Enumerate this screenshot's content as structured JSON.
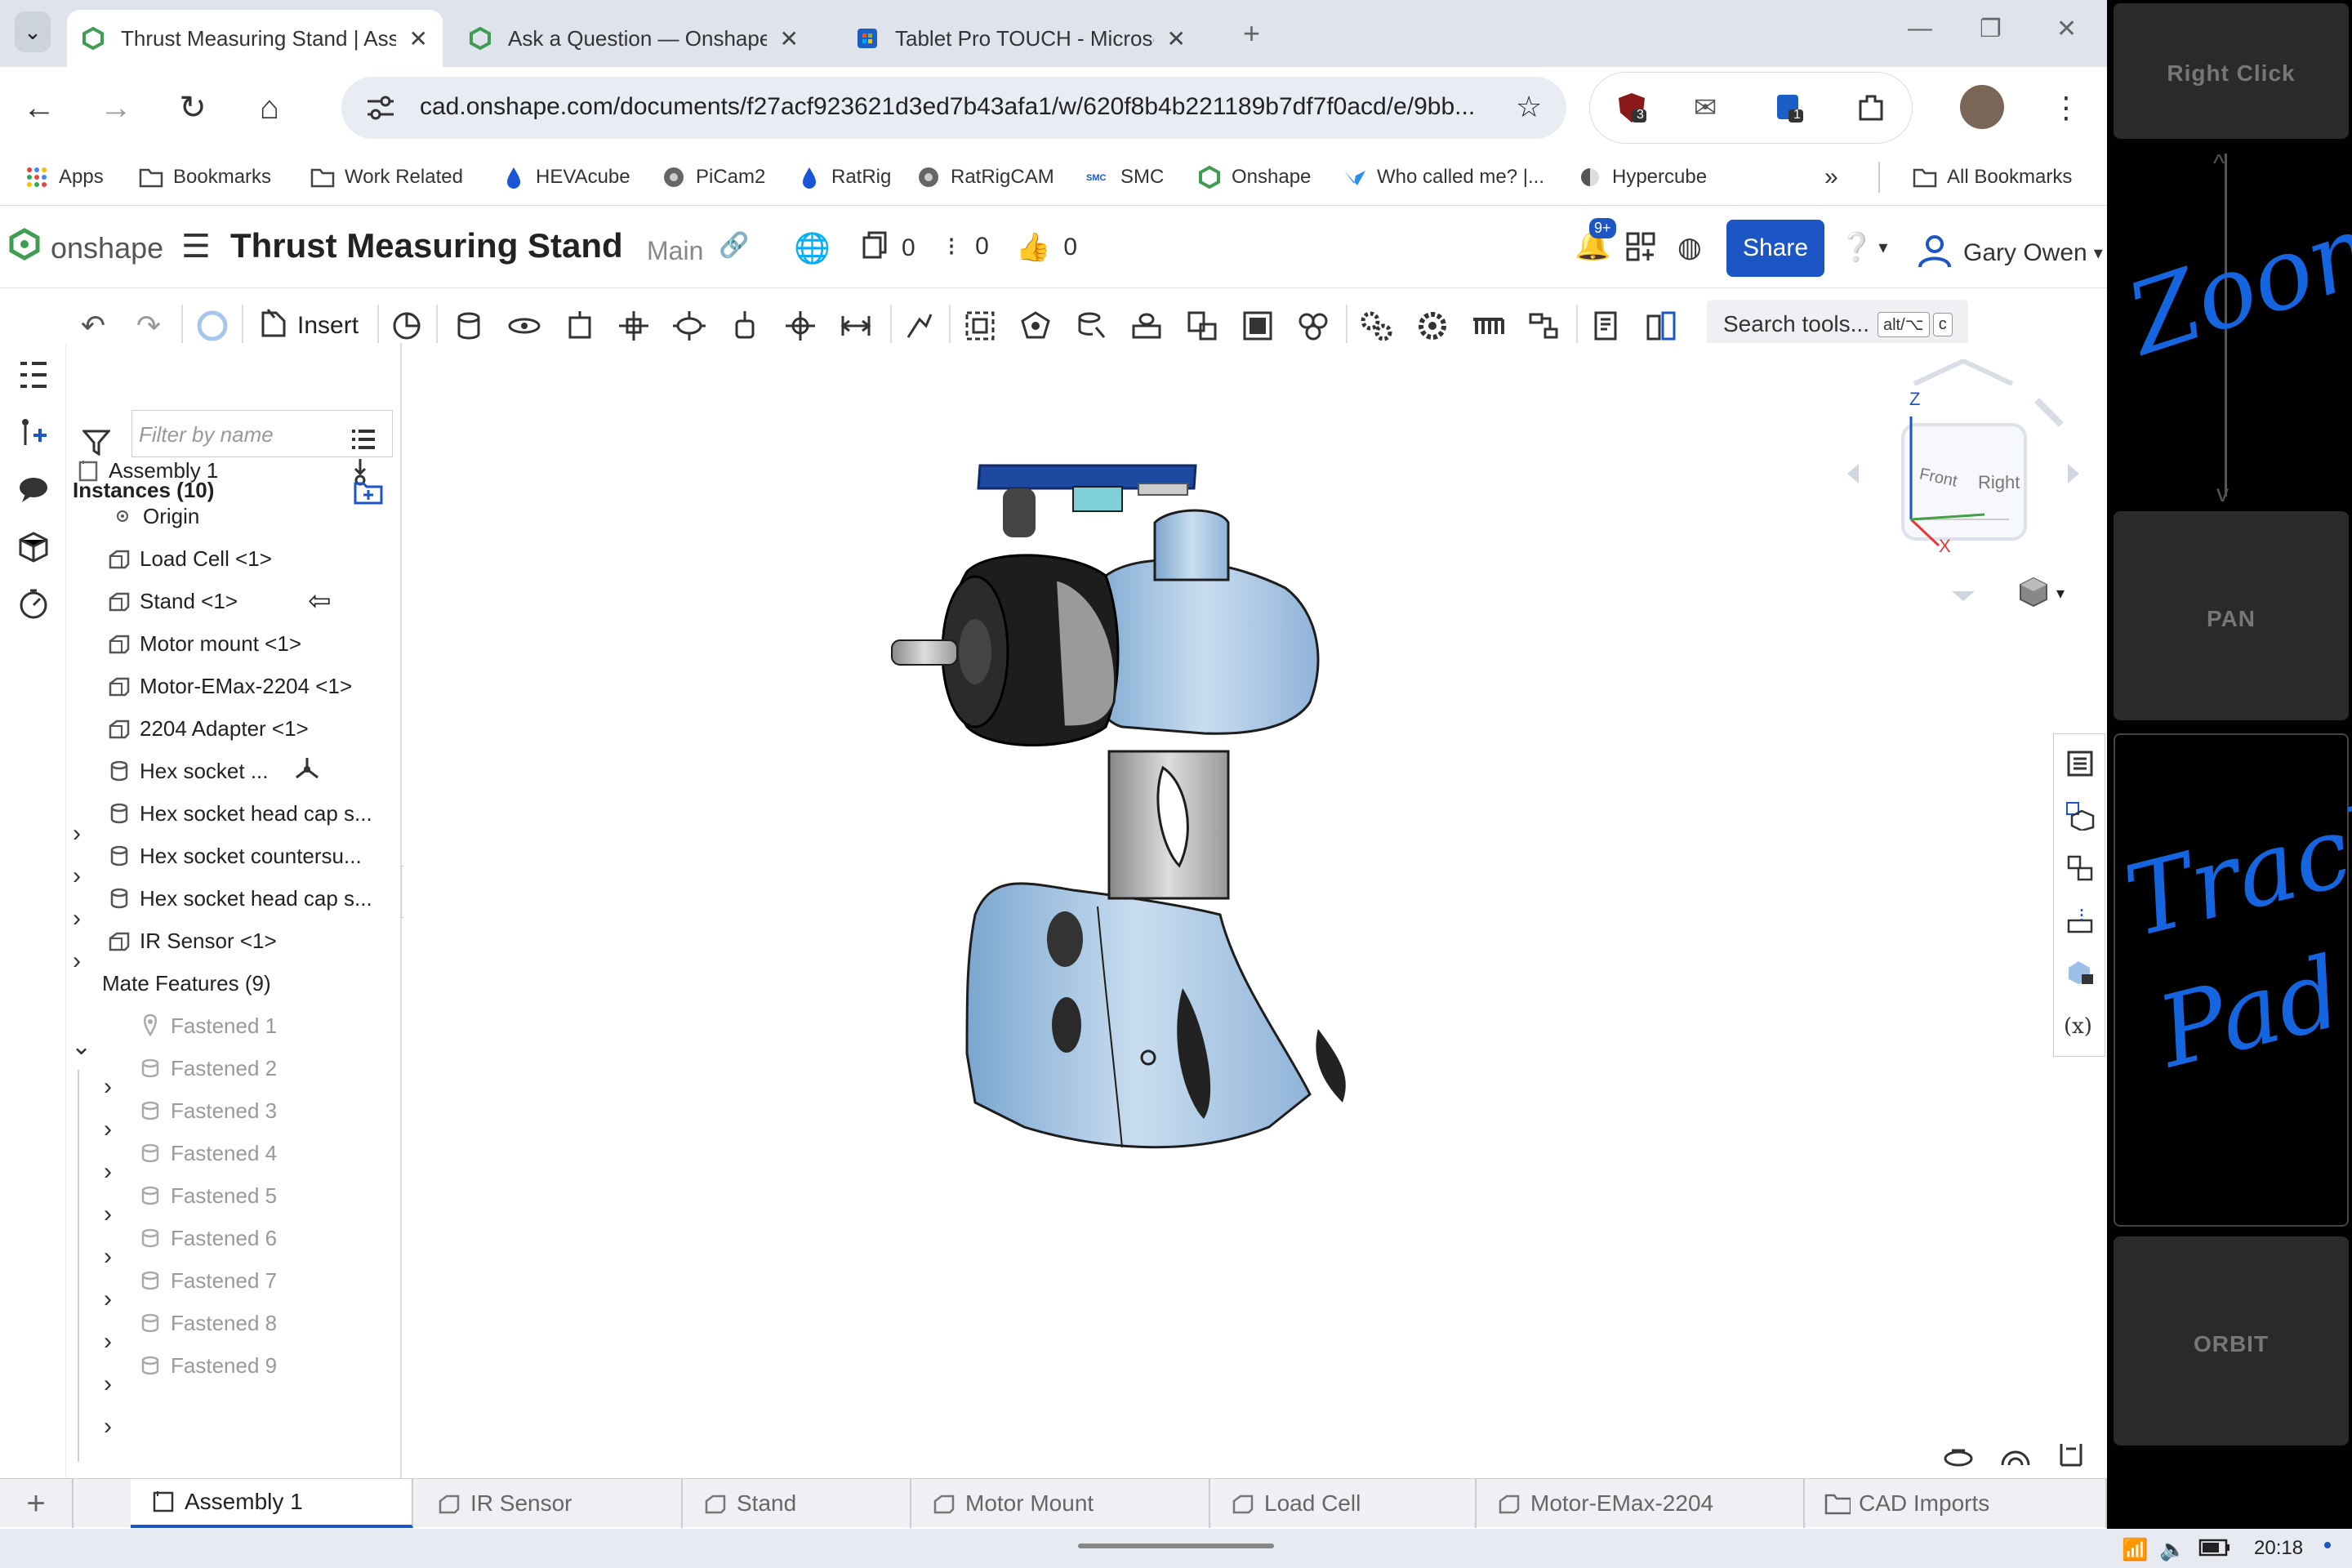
{
  "browser": {
    "tabs": [
      {
        "title": "Thrust Measuring Stand | Assembly 1",
        "active": true
      },
      {
        "title": "Ask a Question — Onshape",
        "active": false
      },
      {
        "title": "Tablet Pro TOUCH - Microsoft Store",
        "active": false
      }
    ],
    "url": "cad.onshape.com/documents/f27acf923621d3ed7b43afa1/w/620f8b4b221189b7df7f0acd/e/9bb...",
    "ext_badge_1": "3",
    "ext_badge_2": "1",
    "bookmarks": [
      "Apps",
      "Bookmarks",
      "Work Related",
      "HEVAcube",
      "PiCam2",
      "RatRig",
      "RatRigCAM",
      "SMC",
      "Onshape",
      "Who called me? |...",
      "Hypercube"
    ],
    "more_bookmarks": "»",
    "all_bookmarks": "All Bookmarks"
  },
  "onshape": {
    "logo_text": "onshape",
    "doc_title": "Thrust Measuring Stand",
    "branch": "Main",
    "versions_count": "0",
    "comments_count": "0",
    "likes_count": "0",
    "notif_badge": "9+",
    "share_label": "Share",
    "user_name": "Gary Owen",
    "insert_label": "Insert",
    "search_tools": "Search tools...",
    "search_kbd_1": "alt/⌥",
    "search_kbd_2": "c"
  },
  "panel": {
    "filter_placeholder": "Filter by name",
    "assembly_label": "Assembly 1",
    "instances_label": "Instances (10)",
    "instances": [
      {
        "label": "Origin"
      },
      {
        "label": "Load Cell <1>"
      },
      {
        "label": "Stand <1>"
      },
      {
        "label": "Motor mount <1>"
      },
      {
        "label": "Motor-EMax-2204 <1>"
      },
      {
        "label": "2204 Adapter <1>"
      },
      {
        "label": "Hex socket ..."
      },
      {
        "label": "Hex socket head cap s..."
      },
      {
        "label": "Hex socket countersu..."
      },
      {
        "label": "Hex socket head cap s..."
      },
      {
        "label": "IR Sensor <1>"
      }
    ],
    "mate_features_label": "Mate Features (9)",
    "mates": [
      "Fastened 1",
      "Fastened 2",
      "Fastened 3",
      "Fastened 4",
      "Fastened 5",
      "Fastened 6",
      "Fastened 7",
      "Fastened 8",
      "Fastened 9"
    ]
  },
  "viewcube": {
    "front": "Front",
    "right": "Right",
    "z": "Z",
    "x": "X"
  },
  "bottom_tabs": [
    "Assembly 1",
    "IR Sensor",
    "Stand",
    "Motor Mount",
    "Load Cell",
    "Motor-EMax-2204",
    "CAD Imports"
  ],
  "add_tab": "+",
  "status": {
    "time": "20:18"
  },
  "side_panel": {
    "right_click": "Right Click",
    "zoom_handwriting": "Zoom",
    "pan": "PAN",
    "track_handwriting": "Track",
    "pad_handwriting": "Pad",
    "orbit": "ORBIT"
  },
  "colors": {
    "accent": "#1b56c4",
    "model_blue": "#a9c8e6",
    "model_dark": "#1d1d1d",
    "handwriting": "#1565e0"
  }
}
